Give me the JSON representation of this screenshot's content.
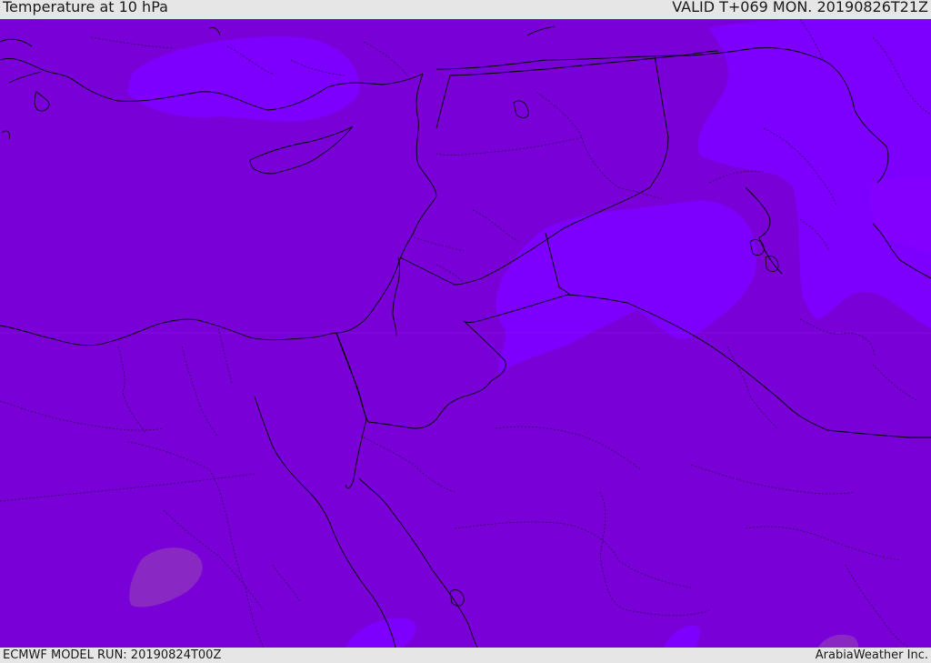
{
  "header": {
    "title": "Temperature at 10 hPa",
    "valid": "VALID T+069 MON. 20190826T21Z"
  },
  "footer": {
    "model_run": "ECMWF MODEL RUN: 20190824T00Z",
    "credit": "ArabiaWeather Inc."
  },
  "map": {
    "region": "Eastern Mediterranean and Middle East",
    "field": "temperature",
    "colors": {
      "base_fill": "#7a00d8",
      "warm_patch": "#7e10e8",
      "lighter_band": "#7d00ff",
      "cool_patch": "#8220c0",
      "coastline": "#000000",
      "border_dotted": "#2a0050"
    }
  }
}
